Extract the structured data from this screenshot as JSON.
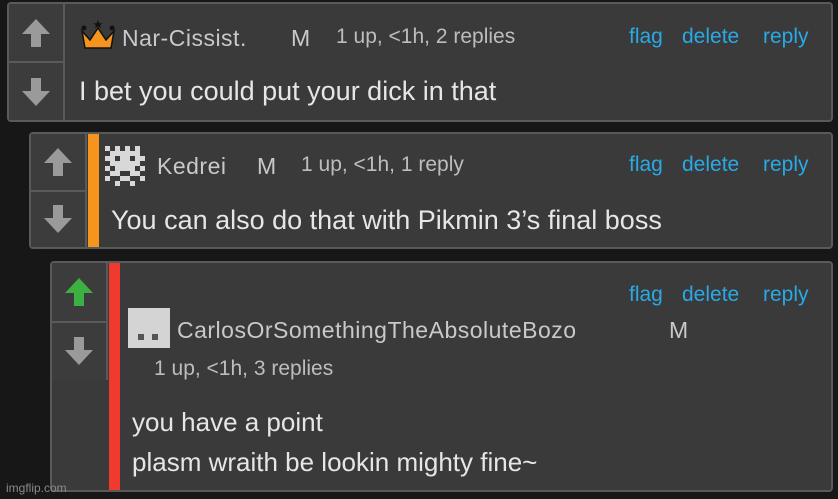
{
  "comments": [
    {
      "username": "Nar-Cissist.",
      "gender": "M",
      "meta": "1 up, <1h, 2 replies",
      "actions": [
        "flag",
        "delete",
        "reply"
      ],
      "body": [
        "I bet you could put your dick in that"
      ]
    },
    {
      "username": "Kedrei",
      "gender": "M",
      "meta": "1 up, <1h, 1 reply",
      "actions": [
        "flag",
        "delete",
        "reply"
      ],
      "body": [
        "You can also do that with Pikmin 3’s final boss"
      ],
      "accent_color": "#f7941d"
    },
    {
      "username": "CarlosOrSomethingTheAbsoluteBozo",
      "gender": "M",
      "meta": "1 up, <1h, 3 replies",
      "actions": [
        "flag",
        "delete",
        "reply"
      ],
      "body": [
        "you have a point",
        "plasm wraith be lookin mighty fine~"
      ],
      "accent_color": "#f03a2e",
      "upvoted": true
    }
  ],
  "colors": {
    "upvote_active": "#3cb043",
    "arrow_inactive": "#9a9a9a",
    "link": "#29a9e8"
  },
  "icons": [
    "up-arrow-icon",
    "down-arrow-icon",
    "crown-icon",
    "pixel-avatar-icon",
    "blank-avatar-icon"
  ],
  "watermark": "imgflip.com"
}
